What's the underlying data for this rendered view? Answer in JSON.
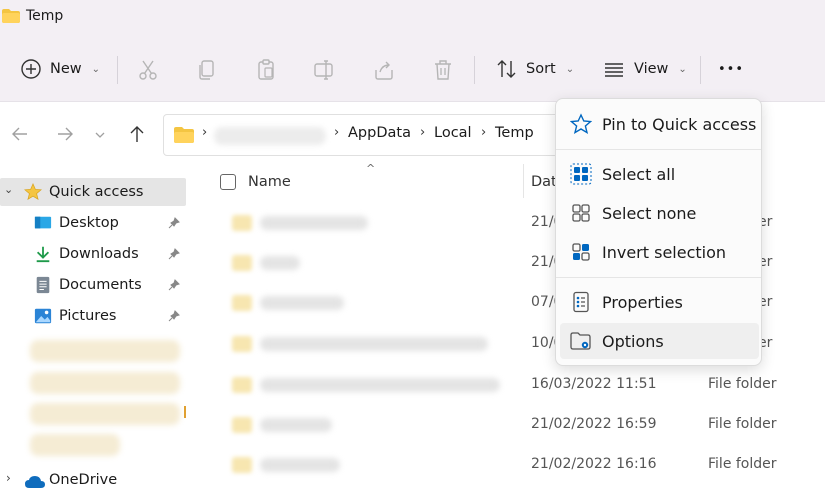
{
  "window": {
    "title": "Temp"
  },
  "toolbar": {
    "new_label": "New",
    "sort_label": "Sort",
    "view_label": "View",
    "more_label": "•••"
  },
  "address": {
    "crumbs": [
      "AppData",
      "Local",
      "Temp"
    ]
  },
  "sidebar": {
    "quick_access": "Quick access",
    "items": [
      {
        "label": "Desktop"
      },
      {
        "label": "Downloads"
      },
      {
        "label": "Documents"
      },
      {
        "label": "Pictures"
      }
    ],
    "onedrive": "OneDrive"
  },
  "table": {
    "col_name": "Name",
    "col_date": "Dat",
    "rows": [
      {
        "date": "21/0",
        "type": "er"
      },
      {
        "date": "21/0",
        "type": "er"
      },
      {
        "date": "07/0",
        "type": "er"
      },
      {
        "date": "10/0",
        "type": "er"
      },
      {
        "date": "16/03/2022 11:51",
        "type": "File folder"
      },
      {
        "date": "21/02/2022 16:59",
        "type": "File folder"
      },
      {
        "date": "21/02/2022 16:16",
        "type": "File folder"
      }
    ]
  },
  "menu": {
    "pin": "Pin to Quick access",
    "select_all": "Select all",
    "select_none": "Select none",
    "invert": "Invert selection",
    "properties": "Properties",
    "options": "Options"
  },
  "colors": {
    "accent": "#0067c0",
    "folder": "#f4c542",
    "chrome": "#f3eff4"
  }
}
